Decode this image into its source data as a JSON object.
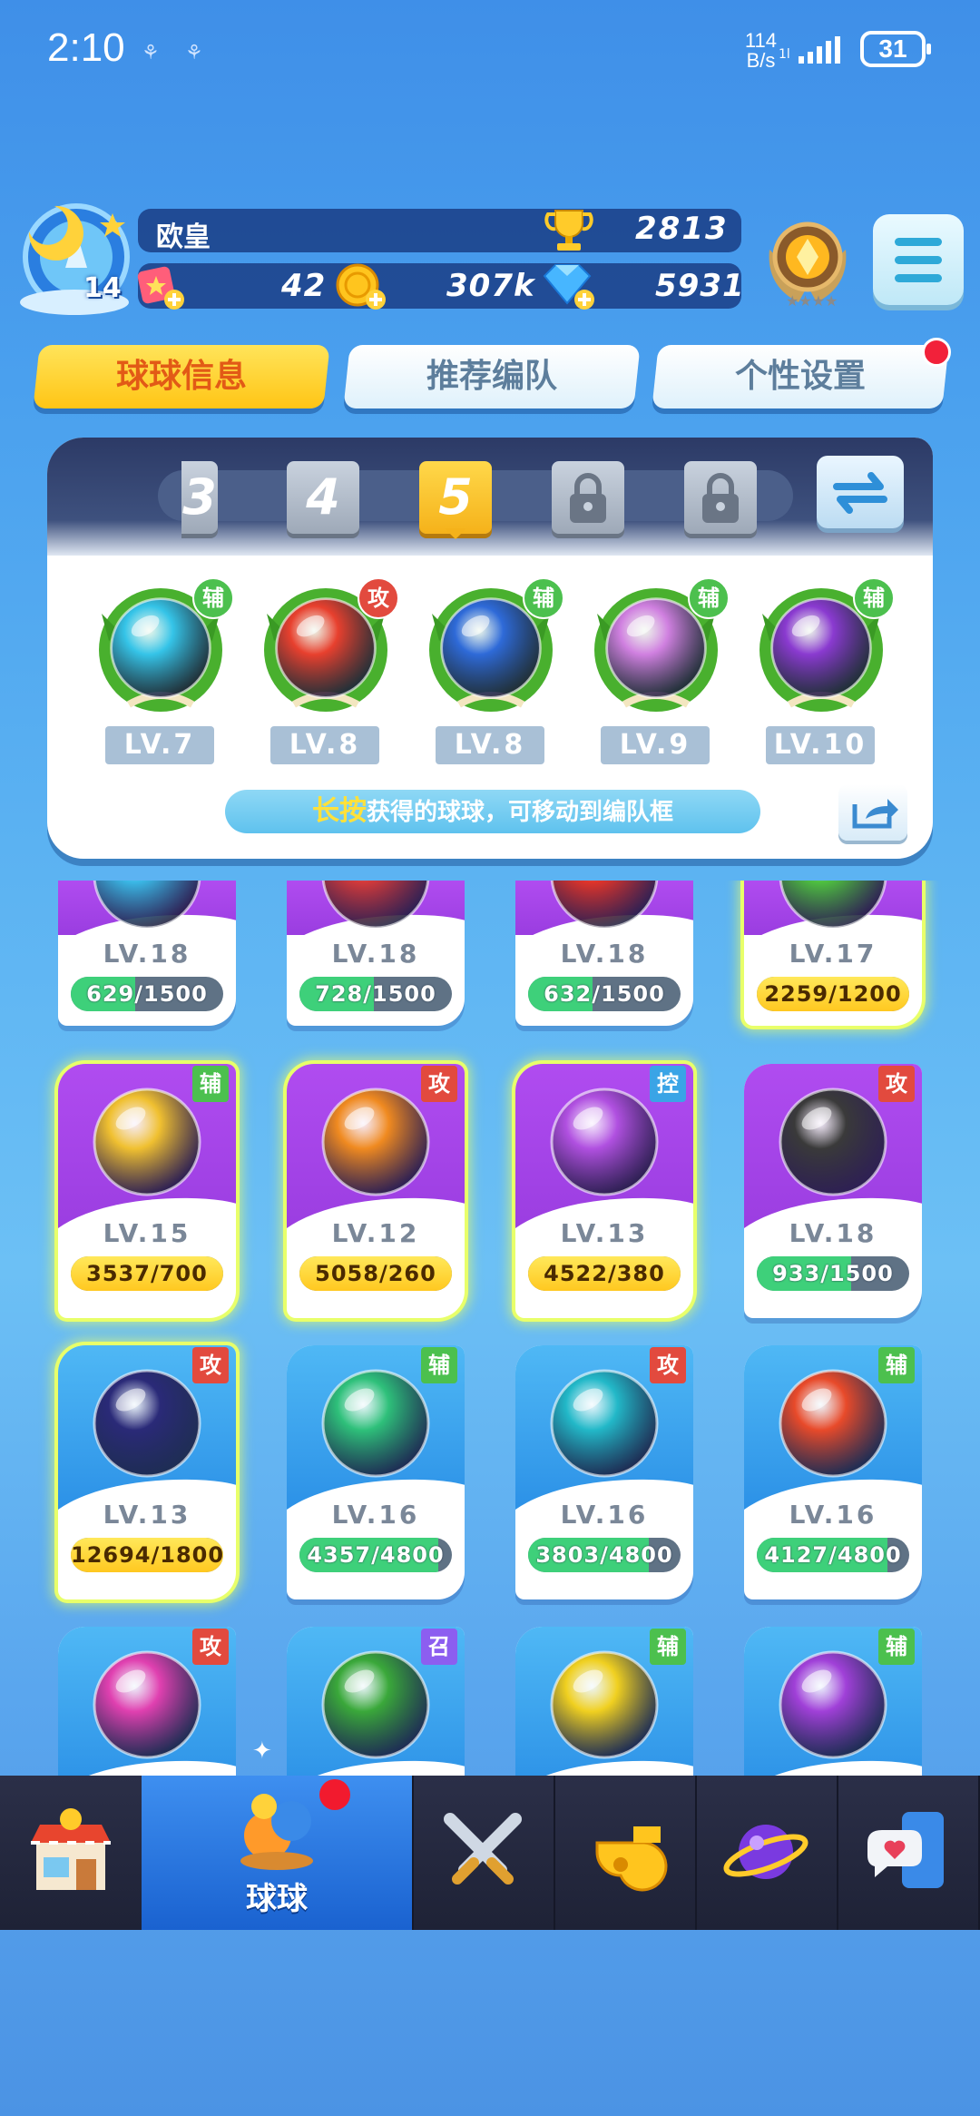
{
  "status": {
    "time": "2:10",
    "net_speed_top": "114",
    "net_speed_bottom": "B/s",
    "battery": "31"
  },
  "player": {
    "name": "欧皇",
    "level": "14",
    "trophies": "2813",
    "tickets": "42",
    "coins": "307k",
    "gems": "5931"
  },
  "tabs": [
    {
      "label": "球球信息"
    },
    {
      "label": "推荐编队"
    },
    {
      "label": "个性设置"
    }
  ],
  "team": {
    "slots": [
      "3",
      "4",
      "5"
    ],
    "active_slot": "5",
    "members": [
      {
        "level": "LV.7",
        "tag": "辅",
        "tag_color": "green",
        "color": "#35c4e8",
        "icon": "swirl-ball-icon"
      },
      {
        "level": "LV.8",
        "tag": "攻",
        "tag_color": "red",
        "color": "#e8402e",
        "icon": "blast-ball-icon"
      },
      {
        "level": "LV.8",
        "tag": "辅",
        "tag_color": "green",
        "color": "#2e6ad8",
        "icon": "hexagon-ball-icon"
      },
      {
        "level": "LV.9",
        "tag": "辅",
        "tag_color": "green",
        "color": "#d080e0",
        "icon": "clone-ball-icon"
      },
      {
        "level": "LV.10",
        "tag": "辅",
        "tag_color": "green",
        "color": "#8a3ad0",
        "icon": "leaf-ball-icon"
      }
    ],
    "hint_highlight": "长按",
    "hint_text": "获得的球球，可移动到编队框"
  },
  "cards": [
    {
      "level": "LV.18",
      "progress": "629/1500",
      "fill": 0.42,
      "fill_color": "green",
      "bg": "purple",
      "ball_color": "#3ab8e6",
      "icon": "wave-ball-icon",
      "glow": false,
      "tag": ""
    },
    {
      "level": "LV.18",
      "progress": "728/1500",
      "fill": 0.49,
      "fill_color": "green",
      "bg": "purple",
      "ball_color": "#d43a3a",
      "icon": "mouth-ball-icon",
      "glow": false,
      "tag": ""
    },
    {
      "level": "LV.18",
      "progress": "632/1500",
      "fill": 0.42,
      "fill_color": "green",
      "bg": "purple",
      "ball_color": "#e0342a",
      "icon": "blade-ball-icon",
      "glow": false,
      "tag": ""
    },
    {
      "level": "LV.17",
      "progress": "2259/1200",
      "fill": 1,
      "fill_color": "gold",
      "bg": "purple",
      "ball_color": "#4ec040",
      "icon": "green-ball-icon",
      "glow": true,
      "tag": ""
    },
    {
      "level": "LV.15",
      "progress": "3537/700",
      "fill": 1,
      "fill_color": "gold",
      "bg": "purple",
      "ball_color": "#f0c030",
      "icon": "mask-ball-icon",
      "glow": true,
      "tag": "辅",
      "tag_color": "green"
    },
    {
      "level": "LV.12",
      "progress": "5058/260",
      "fill": 1,
      "fill_color": "gold",
      "bg": "purple",
      "ball_color": "#f08a20",
      "icon": "staff-ball-icon",
      "glow": true,
      "tag": "攻",
      "tag_color": "red"
    },
    {
      "level": "LV.13",
      "progress": "4522/380",
      "fill": 1,
      "fill_color": "gold",
      "bg": "purple",
      "ball_color": "#b050e0",
      "icon": "cloud-ball-icon",
      "glow": true,
      "tag": "控",
      "tag_color": "blue"
    },
    {
      "level": "LV.18",
      "progress": "933/1500",
      "fill": 0.62,
      "fill_color": "green",
      "bg": "purple",
      "ball_color": "#3a3a3a",
      "icon": "scythe-ball-icon",
      "glow": false,
      "tag": "攻",
      "tag_color": "red"
    },
    {
      "level": "LV.13",
      "progress": "12694/1800",
      "fill": 1,
      "fill_color": "gold",
      "bg": "blue",
      "ball_color": "#2a2a78",
      "icon": "meteor-ball-icon",
      "glow": true,
      "tag": "攻",
      "tag_color": "red"
    },
    {
      "level": "LV.16",
      "progress": "4357/4800",
      "fill": 0.91,
      "fill_color": "green",
      "bg": "blue",
      "ball_color": "#2ec07a",
      "icon": "sp-hands-ball-icon",
      "glow": false,
      "tag": "辅",
      "tag_color": "green"
    },
    {
      "level": "LV.16",
      "progress": "3803/4800",
      "fill": 0.79,
      "fill_color": "green",
      "bg": "blue",
      "ball_color": "#22b8c8",
      "icon": "sp-sword-ball-icon",
      "glow": false,
      "tag": "攻",
      "tag_color": "red"
    },
    {
      "level": "LV.16",
      "progress": "4127/4800",
      "fill": 0.86,
      "fill_color": "green",
      "bg": "blue",
      "ball_color": "#e84a2a",
      "icon": "swords-up-ball-icon",
      "glow": false,
      "tag": "辅",
      "tag_color": "green"
    },
    {
      "level": "",
      "progress": "",
      "fill": 0,
      "fill_color": "green",
      "bg": "blue",
      "ball_color": "#e040b0",
      "icon": "broken-shield-ball-icon",
      "glow": false,
      "tag": "攻",
      "tag_color": "red"
    },
    {
      "level": "",
      "progress": "",
      "fill": 0,
      "fill_color": "green",
      "bg": "blue",
      "ball_color": "#3aa83a",
      "icon": "vine-ball-icon",
      "glow": false,
      "tag": "召",
      "tag_color": "purple"
    },
    {
      "level": "",
      "progress": "",
      "fill": 0,
      "fill_color": "green",
      "bg": "blue",
      "ball_color": "#f0d020",
      "icon": "arrow-up-ball-icon",
      "glow": false,
      "tag": "辅",
      "tag_color": "green"
    },
    {
      "level": "",
      "progress": "",
      "fill": 0,
      "fill_color": "green",
      "bg": "blue",
      "ball_color": "#a040d8",
      "icon": "sp-ball-icon",
      "glow": false,
      "tag": "辅",
      "tag_color": "green"
    }
  ],
  "nav": [
    {
      "icon": "shop-icon"
    },
    {
      "icon": "balls-icon",
      "label": "球球"
    },
    {
      "icon": "crossed-swords-icon"
    },
    {
      "icon": "whistle-icon"
    },
    {
      "icon": "planet-icon"
    },
    {
      "icon": "chat-phone-icon"
    }
  ]
}
